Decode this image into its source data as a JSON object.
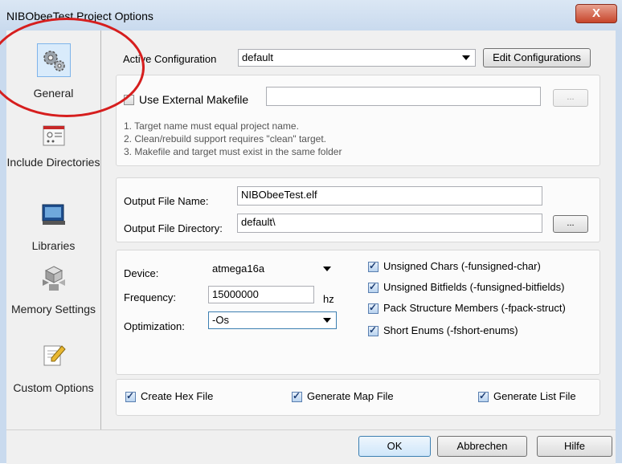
{
  "window": {
    "title": "NIBObeeTest Project Options",
    "close_label": "X"
  },
  "sidebar": {
    "items": [
      {
        "label": "General",
        "icon": "gear-icon",
        "selected": true
      },
      {
        "label": "Include Directories",
        "icon": "folder-config-icon"
      },
      {
        "label": "Libraries",
        "icon": "library-book-icon"
      },
      {
        "label": "Memory Settings",
        "icon": "memory-blocks-icon"
      },
      {
        "label": "Custom Options",
        "icon": "notepad-pencil-icon"
      }
    ]
  },
  "config": {
    "label": "Active Configuration",
    "value": "default",
    "edit_button": "Edit Configurations"
  },
  "makefile": {
    "checkbox_label": "Use External Makefile",
    "browse_label": "...",
    "notes": [
      "1. Target name must equal project name.",
      "2. Clean/rebuild support requires  \"clean\" target.",
      "3. Makefile and target must exist in the same folder"
    ]
  },
  "output": {
    "file_name_label": "Output File Name:",
    "file_name_value": "NIBObeeTest.elf",
    "directory_label": "Output File Directory:",
    "directory_value": "default\\",
    "browse_label": "..."
  },
  "device": {
    "device_label": "Device:",
    "device_value": "atmega16a",
    "frequency_label": "Frequency:",
    "frequency_value": "15000000",
    "frequency_unit": "hz",
    "optimization_label": "Optimization:",
    "optimization_value": "-Os"
  },
  "flags": [
    {
      "label": "Unsigned Chars (-funsigned-char)",
      "checked": true
    },
    {
      "label": "Unsigned Bitfields (-funsigned-bitfields)",
      "checked": true
    },
    {
      "label": "Pack Structure Members (-fpack-struct)",
      "checked": true
    },
    {
      "label": "Short Enums (-fshort-enums)",
      "checked": true
    }
  ],
  "outputs": [
    {
      "label": "Create Hex File",
      "checked": true
    },
    {
      "label": "Generate Map File",
      "checked": true
    },
    {
      "label": "Generate List File",
      "checked": true
    }
  ],
  "buttons": {
    "ok": "OK",
    "cancel": "Abbrechen",
    "help": "Hilfe"
  },
  "colors": {
    "annotation": "#d61e1e",
    "selection": "#d9ebfb",
    "title_bar": "#c9daee"
  }
}
